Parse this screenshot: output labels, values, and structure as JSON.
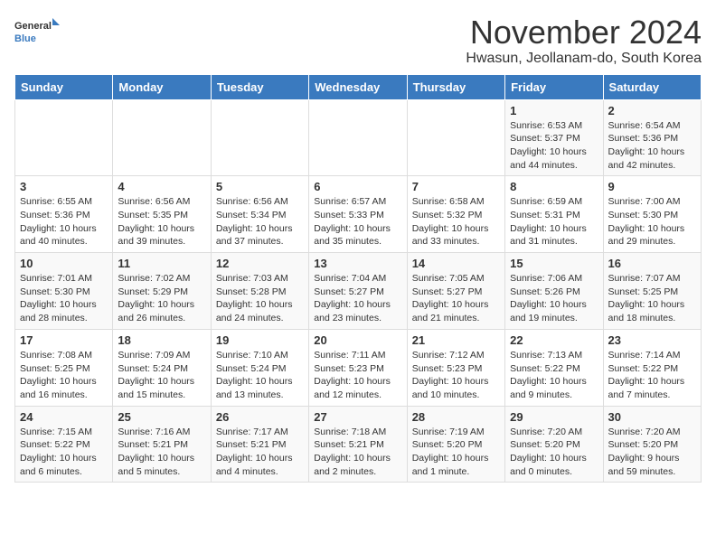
{
  "header": {
    "logo_general": "General",
    "logo_blue": "Blue",
    "title": "November 2024",
    "subtitle": "Hwasun, Jeollanam-do, South Korea"
  },
  "calendar": {
    "columns": [
      "Sunday",
      "Monday",
      "Tuesday",
      "Wednesday",
      "Thursday",
      "Friday",
      "Saturday"
    ],
    "rows": [
      [
        {
          "day": "",
          "text": ""
        },
        {
          "day": "",
          "text": ""
        },
        {
          "day": "",
          "text": ""
        },
        {
          "day": "",
          "text": ""
        },
        {
          "day": "",
          "text": ""
        },
        {
          "day": "1",
          "text": "Sunrise: 6:53 AM\nSunset: 5:37 PM\nDaylight: 10 hours and 44 minutes."
        },
        {
          "day": "2",
          "text": "Sunrise: 6:54 AM\nSunset: 5:36 PM\nDaylight: 10 hours and 42 minutes."
        }
      ],
      [
        {
          "day": "3",
          "text": "Sunrise: 6:55 AM\nSunset: 5:36 PM\nDaylight: 10 hours and 40 minutes."
        },
        {
          "day": "4",
          "text": "Sunrise: 6:56 AM\nSunset: 5:35 PM\nDaylight: 10 hours and 39 minutes."
        },
        {
          "day": "5",
          "text": "Sunrise: 6:56 AM\nSunset: 5:34 PM\nDaylight: 10 hours and 37 minutes."
        },
        {
          "day": "6",
          "text": "Sunrise: 6:57 AM\nSunset: 5:33 PM\nDaylight: 10 hours and 35 minutes."
        },
        {
          "day": "7",
          "text": "Sunrise: 6:58 AM\nSunset: 5:32 PM\nDaylight: 10 hours and 33 minutes."
        },
        {
          "day": "8",
          "text": "Sunrise: 6:59 AM\nSunset: 5:31 PM\nDaylight: 10 hours and 31 minutes."
        },
        {
          "day": "9",
          "text": "Sunrise: 7:00 AM\nSunset: 5:30 PM\nDaylight: 10 hours and 29 minutes."
        }
      ],
      [
        {
          "day": "10",
          "text": "Sunrise: 7:01 AM\nSunset: 5:30 PM\nDaylight: 10 hours and 28 minutes."
        },
        {
          "day": "11",
          "text": "Sunrise: 7:02 AM\nSunset: 5:29 PM\nDaylight: 10 hours and 26 minutes."
        },
        {
          "day": "12",
          "text": "Sunrise: 7:03 AM\nSunset: 5:28 PM\nDaylight: 10 hours and 24 minutes."
        },
        {
          "day": "13",
          "text": "Sunrise: 7:04 AM\nSunset: 5:27 PM\nDaylight: 10 hours and 23 minutes."
        },
        {
          "day": "14",
          "text": "Sunrise: 7:05 AM\nSunset: 5:27 PM\nDaylight: 10 hours and 21 minutes."
        },
        {
          "day": "15",
          "text": "Sunrise: 7:06 AM\nSunset: 5:26 PM\nDaylight: 10 hours and 19 minutes."
        },
        {
          "day": "16",
          "text": "Sunrise: 7:07 AM\nSunset: 5:25 PM\nDaylight: 10 hours and 18 minutes."
        }
      ],
      [
        {
          "day": "17",
          "text": "Sunrise: 7:08 AM\nSunset: 5:25 PM\nDaylight: 10 hours and 16 minutes."
        },
        {
          "day": "18",
          "text": "Sunrise: 7:09 AM\nSunset: 5:24 PM\nDaylight: 10 hours and 15 minutes."
        },
        {
          "day": "19",
          "text": "Sunrise: 7:10 AM\nSunset: 5:24 PM\nDaylight: 10 hours and 13 minutes."
        },
        {
          "day": "20",
          "text": "Sunrise: 7:11 AM\nSunset: 5:23 PM\nDaylight: 10 hours and 12 minutes."
        },
        {
          "day": "21",
          "text": "Sunrise: 7:12 AM\nSunset: 5:23 PM\nDaylight: 10 hours and 10 minutes."
        },
        {
          "day": "22",
          "text": "Sunrise: 7:13 AM\nSunset: 5:22 PM\nDaylight: 10 hours and 9 minutes."
        },
        {
          "day": "23",
          "text": "Sunrise: 7:14 AM\nSunset: 5:22 PM\nDaylight: 10 hours and 7 minutes."
        }
      ],
      [
        {
          "day": "24",
          "text": "Sunrise: 7:15 AM\nSunset: 5:22 PM\nDaylight: 10 hours and 6 minutes."
        },
        {
          "day": "25",
          "text": "Sunrise: 7:16 AM\nSunset: 5:21 PM\nDaylight: 10 hours and 5 minutes."
        },
        {
          "day": "26",
          "text": "Sunrise: 7:17 AM\nSunset: 5:21 PM\nDaylight: 10 hours and 4 minutes."
        },
        {
          "day": "27",
          "text": "Sunrise: 7:18 AM\nSunset: 5:21 PM\nDaylight: 10 hours and 2 minutes."
        },
        {
          "day": "28",
          "text": "Sunrise: 7:19 AM\nSunset: 5:20 PM\nDaylight: 10 hours and 1 minute."
        },
        {
          "day": "29",
          "text": "Sunrise: 7:20 AM\nSunset: 5:20 PM\nDaylight: 10 hours and 0 minutes."
        },
        {
          "day": "30",
          "text": "Sunrise: 7:20 AM\nSunset: 5:20 PM\nDaylight: 9 hours and 59 minutes."
        }
      ]
    ]
  }
}
